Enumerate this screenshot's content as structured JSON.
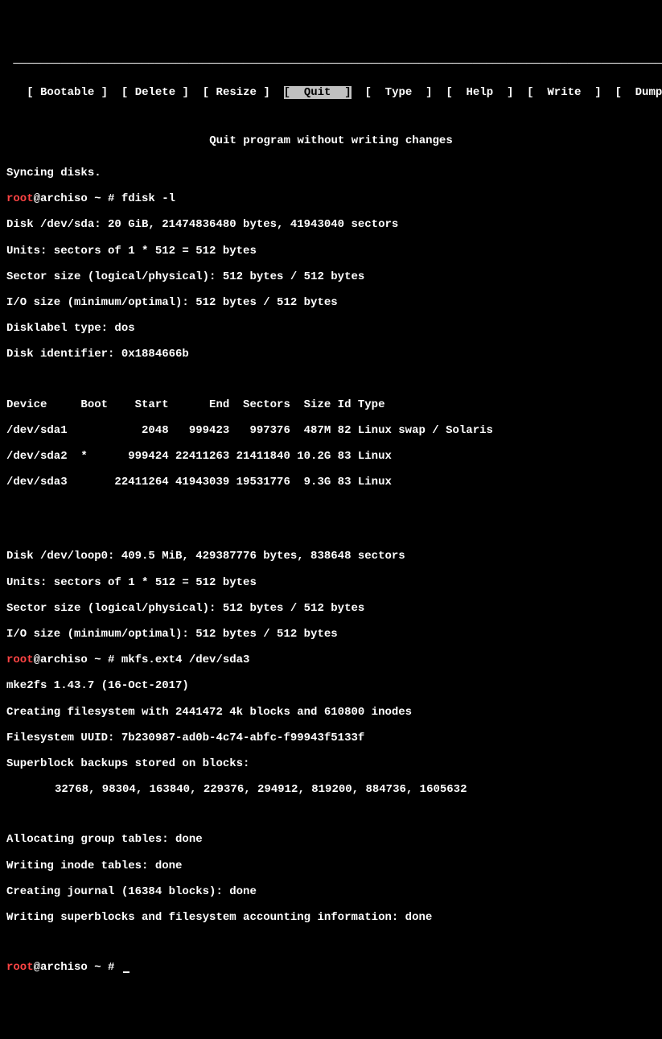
{
  "hr": " ─────────────────────────────────────────────────────────────────────────────────────────────────────────",
  "menu": {
    "items": [
      {
        "label": "Bootable",
        "selected": false
      },
      {
        "label": "Delete",
        "selected": false
      },
      {
        "label": "Resize",
        "selected": false
      },
      {
        "label": "Quit",
        "selected": true
      },
      {
        "label": "Type",
        "selected": false
      },
      {
        "label": "Help",
        "selected": false
      },
      {
        "label": "Write",
        "selected": false
      },
      {
        "label": "Dump",
        "selected": false
      }
    ]
  },
  "subtitle": "Quit program without writing changes",
  "sync": "Syncing disks.",
  "prompt_user": "root",
  "prompt_host": "@archiso ~ # ",
  "cmd1": "fdisk -l",
  "disk_sda": {
    "header": "Disk /dev/sda: 20 GiB, 21474836480 bytes, 41943040 sectors",
    "units": "Units: sectors of 1 * 512 = 512 bytes",
    "sector": "Sector size (logical/physical): 512 bytes / 512 bytes",
    "io": "I/O size (minimum/optimal): 512 bytes / 512 bytes",
    "label": "Disklabel type: dos",
    "ident": "Disk identifier: 0x1884666b"
  },
  "ptable_head": "Device     Boot    Start      End  Sectors  Size Id Type",
  "ptable_rows": [
    "/dev/sda1           2048   999423   997376  487M 82 Linux swap / Solaris",
    "/dev/sda2  *      999424 22411263 21411840 10.2G 83 Linux",
    "/dev/sda3       22411264 41943039 19531776  9.3G 83 Linux"
  ],
  "disk_loop": {
    "header": "Disk /dev/loop0: 409.5 MiB, 429387776 bytes, 838648 sectors",
    "units": "Units: sectors of 1 * 512 = 512 bytes",
    "sector": "Sector size (logical/physical): 512 bytes / 512 bytes",
    "io": "I/O size (minimum/optimal): 512 bytes / 512 bytes"
  },
  "cmd2": "mkfs.ext4 /dev/sda3",
  "mke2fs": [
    "mke2fs 1.43.7 (16-Oct-2017)",
    "Creating filesystem with 2441472 4k blocks and 610800 inodes",
    "Filesystem UUID: 7b230987-ad0b-4c74-abfc-f99943f5133f",
    "Superblock backups stored on blocks: "
  ],
  "sb_blocks": "32768, 98304, 163840, 229376, 294912, 819200, 884736, 1605632",
  "done_lines": [
    "Allocating group tables: done                            ",
    "Writing inode tables: done                            ",
    "Creating journal (16384 blocks): done",
    "Writing superblocks and filesystem accounting information: done"
  ]
}
